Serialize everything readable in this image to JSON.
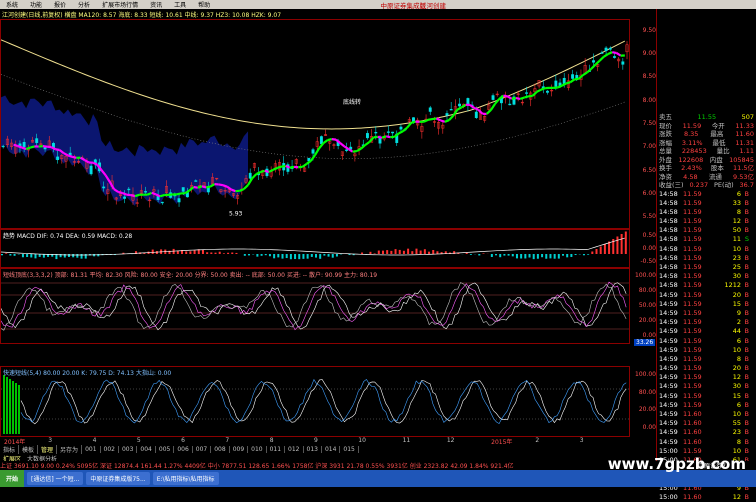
{
  "menu": [
    "系统",
    "功能",
    "报价",
    "分析",
    "扩展市场行情",
    "资讯",
    "工具",
    "帮助"
  ],
  "brand": "中原证券集成版",
  "brand_user": "江河创建",
  "main_title": "江河创建(日线,前复权) 横盘  MA120: 8.57  海底: 8.33  短线: 10.61  中线: 9.37  HZ3: 10.08  HZK: 9.07",
  "main_axis": [
    "9.50",
    "9.00",
    "8.50",
    "8.00",
    "7.50",
    "7.00",
    "6.50",
    "6.00",
    "5.50"
  ],
  "pane2_title": "趋势  MACD  DIF: 0.74  DEA: 0.59  MACD: 0.28",
  "pane2_axis": [
    "0.50",
    "0.00",
    "-0.50"
  ],
  "pane3_title": "短线顶底(3,3,3,2)  顶部: 81.31  平均: 82.30  风险: 80.00  安全: 20.00  分界: 50.00  卖出: -- 底部: 50.00  买进: -- 散户: 90.99  主力: 80.19",
  "pane3_axis": [
    "100.00",
    "80.00",
    "50.00",
    "20.00",
    "0.00"
  ],
  "pane3_mark": "33.26",
  "pane4_title": "快速短线(5,4)  80.00  20.00  K: 79.75  D: 74.13  大指山: 0.00",
  "pane4_axis": [
    "100.00",
    "80.00",
    "20.00",
    "0.00"
  ],
  "date_labels": [
    "2014年",
    "3",
    "4",
    "5",
    "6",
    "7",
    "8",
    "9",
    "10",
    "11",
    "12",
    "2015年",
    "2",
    "3"
  ],
  "bottom_tabs": [
    "指标",
    "模板",
    "管理",
    "另存为",
    "001",
    "002",
    "003",
    "004",
    "005",
    "006",
    "007",
    "008",
    "009",
    "010",
    "011",
    "012",
    "013",
    "014",
    "015"
  ],
  "bottom_tabs2": [
    "扩展区",
    "大数据分析"
  ],
  "chart_data": {
    "type": "candlestick",
    "ylim": [
      5.5,
      9.7
    ],
    "label_price_low": "5.93",
    "annotation": "底线转",
    "ma_long": "yellow",
    "ma_short_up": "#00ff00",
    "ma_short_down": "#ff00ff"
  },
  "quote": {
    "sell5_label": "卖五",
    "sell5_price": "11.55",
    "sell5_vol": "507",
    "rows": [
      {
        "l1": "现价",
        "v1": "11.59",
        "l2": "今开",
        "v2": "11.33"
      },
      {
        "l1": "涨跌",
        "v1": "8.35",
        "l2": "最高",
        "v2": "11.60"
      },
      {
        "l1": "涨幅",
        "v1": "3.11%",
        "l2": "最低",
        "v2": "11.31"
      },
      {
        "l1": "总量",
        "v1": "228453",
        "l2": "量比",
        "v2": "1.11"
      },
      {
        "l1": "外盘",
        "v1": "122608",
        "l2": "内盘",
        "v2": "105845"
      },
      {
        "l1": "换手",
        "v1": "2.43%",
        "l2": "股本",
        "v2": "11.5亿"
      },
      {
        "l1": "净资",
        "v1": "4.58",
        "l2": "流通",
        "v2": "9.53亿"
      },
      {
        "l1": "收益(三)",
        "v1": "0.237",
        "l2": "PE(动)",
        "v2": "36.7"
      }
    ],
    "ticks": [
      {
        "t": "14:58",
        "p": "11.59",
        "v": "6",
        "s": "B"
      },
      {
        "t": "14:58",
        "p": "11.59",
        "v": "33",
        "s": "B"
      },
      {
        "t": "14:58",
        "p": "11.59",
        "v": "8",
        "s": "B"
      },
      {
        "t": "14:58",
        "p": "11.59",
        "v": "12",
        "s": "B"
      },
      {
        "t": "14:58",
        "p": "11.59",
        "v": "50",
        "s": "B"
      },
      {
        "t": "14:58",
        "p": "11.59",
        "v": "11",
        "s": "S"
      },
      {
        "t": "14:58",
        "p": "11.59",
        "v": "10",
        "s": "B"
      },
      {
        "t": "14:58",
        "p": "11.59",
        "v": "23",
        "s": "B"
      },
      {
        "t": "14:58",
        "p": "11.59",
        "v": "25",
        "s": "B"
      },
      {
        "t": "14:58",
        "p": "11.59",
        "v": "30",
        "s": "B"
      },
      {
        "t": "14:58",
        "p": "11.59",
        "v": "1212",
        "s": "B"
      },
      {
        "t": "14:59",
        "p": "11.59",
        "v": "20",
        "s": "B"
      },
      {
        "t": "14:59",
        "p": "11.59",
        "v": "15",
        "s": "B"
      },
      {
        "t": "14:59",
        "p": "11.59",
        "v": "9",
        "s": "B"
      },
      {
        "t": "14:59",
        "p": "11.59",
        "v": "2",
        "s": "B"
      },
      {
        "t": "14:59",
        "p": "11.59",
        "v": "44",
        "s": "B"
      },
      {
        "t": "14:59",
        "p": "11.59",
        "v": "6",
        "s": "B"
      },
      {
        "t": "14:59",
        "p": "11.59",
        "v": "10",
        "s": "B"
      },
      {
        "t": "14:59",
        "p": "11.59",
        "v": "8",
        "s": "B"
      },
      {
        "t": "14:59",
        "p": "11.59",
        "v": "20",
        "s": "B"
      },
      {
        "t": "14:59",
        "p": "11.59",
        "v": "12",
        "s": "B"
      },
      {
        "t": "14:59",
        "p": "11.59",
        "v": "30",
        "s": "B"
      },
      {
        "t": "14:59",
        "p": "11.59",
        "v": "15",
        "s": "B"
      },
      {
        "t": "14:59",
        "p": "11.59",
        "v": "6",
        "s": "B"
      },
      {
        "t": "14:59",
        "p": "11.60",
        "v": "10",
        "s": "B"
      },
      {
        "t": "14:59",
        "p": "11.60",
        "v": "55",
        "s": "B"
      },
      {
        "t": "14:59",
        "p": "11.60",
        "v": "23",
        "s": "B"
      },
      {
        "t": "14:59",
        "p": "11.60",
        "v": "8",
        "s": "B"
      },
      {
        "t": "15:00",
        "p": "11.59",
        "v": "10",
        "s": "B"
      },
      {
        "t": "15:00",
        "p": "11.60",
        "v": "61",
        "s": "B"
      },
      {
        "t": "15:00",
        "p": "11.59",
        "v": "15",
        "s": "B"
      },
      {
        "t": "15:00",
        "p": "11.60",
        "v": "5",
        "s": "B"
      },
      {
        "t": "15:00",
        "p": "11.60",
        "v": "9",
        "s": "B"
      },
      {
        "t": "15:00",
        "p": "11.60",
        "v": "12",
        "s": "B"
      }
    ]
  },
  "index_bar": "上证 3691.10  9.00  0.24%  5095亿  深证 12874.4  161.44  1.27%  4409亿  中小 7877.51  128.65  1.66%  1758亿  沪深 3931  21.78  0.55%  3931亿  创业 2323.82  42.09  1.84%  921.4亿",
  "index_right": "中原证券7",
  "taskbar": {
    "start": "开始",
    "tasks": [
      "[通达信] 一个短...",
      "中原证券集成版75...",
      "E:\\私用指标\\私用指标"
    ]
  },
  "watermark": "www.7gpzb.com"
}
